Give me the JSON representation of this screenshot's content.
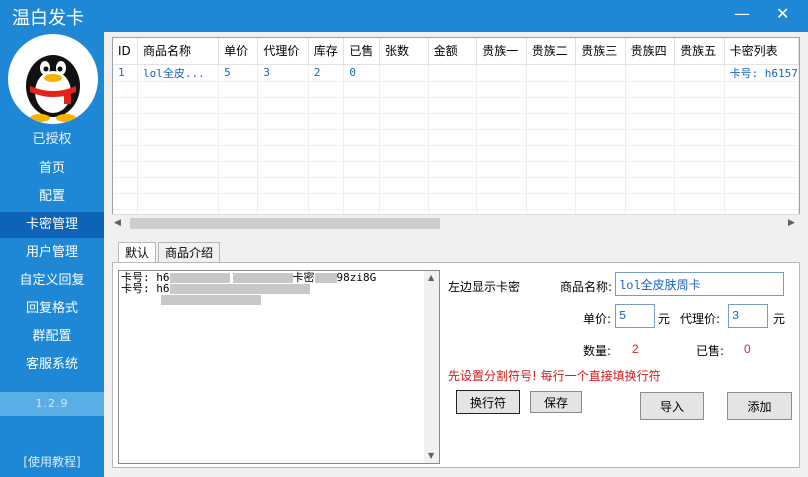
{
  "app": {
    "title": "温白发卡",
    "minimize": "—",
    "close": "✕"
  },
  "sidebar": {
    "auth_status": "已授权",
    "items": [
      {
        "label": "首页"
      },
      {
        "label": "配置"
      },
      {
        "label": "卡密管理"
      },
      {
        "label": "用户管理"
      },
      {
        "label": "自定义回复"
      },
      {
        "label": "回复格式"
      },
      {
        "label": "群配置"
      },
      {
        "label": "客服系统"
      }
    ],
    "active_item": "卡密管理",
    "version": "1.2.9",
    "tutorial": "[使用教程]"
  },
  "table": {
    "columns": [
      "ID",
      "商品名称",
      "单价",
      "代理价",
      "库存",
      "已售",
      "张数",
      "金额",
      "贵族一",
      "贵族二",
      "贵族三",
      "贵族四",
      "贵族五",
      "卡密列表"
    ],
    "rows": [
      [
        "1",
        "lol全皮...",
        "5",
        "3",
        "2",
        "0",
        "",
        "",
        "",
        "",
        "",
        "",
        "",
        "卡号: h6157"
      ]
    ]
  },
  "tabs": [
    {
      "label": "默认"
    },
    {
      "label": "商品介绍"
    }
  ],
  "card_text": {
    "line1_start": "卡号: h6",
    "line1_mid": "卡密",
    "line1_end": "98zi8G",
    "line2_start": "卡号: h6"
  },
  "form": {
    "left_display": "左边显示卡密",
    "product_name_label": "商品名称:",
    "product_name_value": "lol全皮肤周卡",
    "price_label": "单价:",
    "price_value": "5",
    "agent_price_label": "代理价:",
    "agent_price_value": "3",
    "unit": "元",
    "count_label": "数量:",
    "count_value": "2",
    "sold_label": "已售:",
    "sold_value": "0",
    "warning": "先设置分割符号! 每行一个直接填换行符",
    "newline_button": "换行符",
    "save_button": "保存",
    "import_button": "导入",
    "add_button": "添加"
  },
  "colors": {
    "brand": "#1e88d6",
    "active_nav": "#0d63b8",
    "value_blue": "#1a62c6",
    "warning_red": "#d71919"
  }
}
